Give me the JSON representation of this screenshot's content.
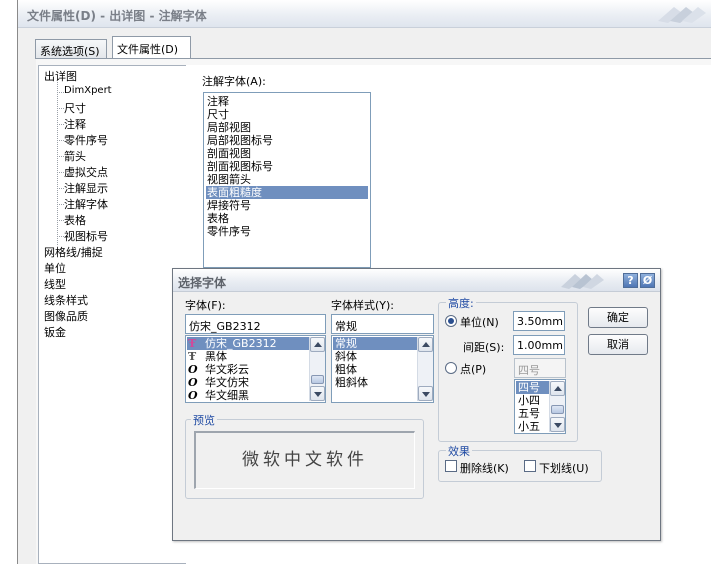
{
  "window": {
    "title": "文件属性(D) - 出详图 - 注解字体",
    "tabs": [
      {
        "label": "系统选项(S)",
        "active": false
      },
      {
        "label": "文件属性(D)",
        "active": true
      }
    ]
  },
  "tree": {
    "items": [
      "出详图",
      "DimXpert",
      "尺寸",
      "注释",
      "零件序号",
      "箭头",
      "虚拟交点",
      "注解显示",
      "注解字体",
      "表格",
      "视图标号",
      "网格线/捕捉",
      "单位",
      "线型",
      "线条样式",
      "图像品质",
      "钣金"
    ]
  },
  "annotation_font": {
    "label": "注解字体(A):",
    "items": [
      "注释",
      "尺寸",
      "局部视图",
      "局部视图标号",
      "剖面视图",
      "剖面视图标号",
      "视图箭头",
      "表面粗糙度",
      "焊接符号",
      "表格",
      "零件序号"
    ],
    "selected": "表面粗糙度"
  },
  "font_dialog": {
    "title": "选择字体",
    "help_label": "?",
    "close_label": "Ø",
    "font": {
      "label": "字体(F):",
      "value": "仿宋_GB2312",
      "items": [
        {
          "name": "仿宋_GB2312",
          "icon": "truetype-icon",
          "selected": true
        },
        {
          "name": "黑体",
          "icon": "truetype-icon",
          "selected": false
        },
        {
          "name": "华文彩云",
          "icon": "opentype-icon",
          "selected": false
        },
        {
          "name": "华文仿宋",
          "icon": "opentype-icon",
          "selected": false
        },
        {
          "name": "华文细黑",
          "icon": "opentype-icon",
          "selected": false
        }
      ]
    },
    "style": {
      "label": "字体样式(Y):",
      "value": "常规",
      "items": [
        "常规",
        "斜体",
        "粗体",
        "粗斜体"
      ],
      "selected": "常规"
    },
    "height": {
      "label": "高度:",
      "unit_label": "单位(N)",
      "unit_value": "3.50mm",
      "spacing_label": "间距(S):",
      "spacing_value": "1.00mm",
      "point_label": "点(P)",
      "point_value": "四号",
      "point_items": [
        "四号",
        "小四",
        "五号",
        "小五"
      ],
      "selected_mode": "unit"
    },
    "preview": {
      "label": "预览",
      "sample": "微软中文软件"
    },
    "effects": {
      "label": "效果",
      "strikeout_label": "删除线(K)",
      "underline_label": "下划线(U)",
      "strikeout": false,
      "underline": false
    },
    "ok_label": "确定",
    "cancel_label": "取消"
  }
}
